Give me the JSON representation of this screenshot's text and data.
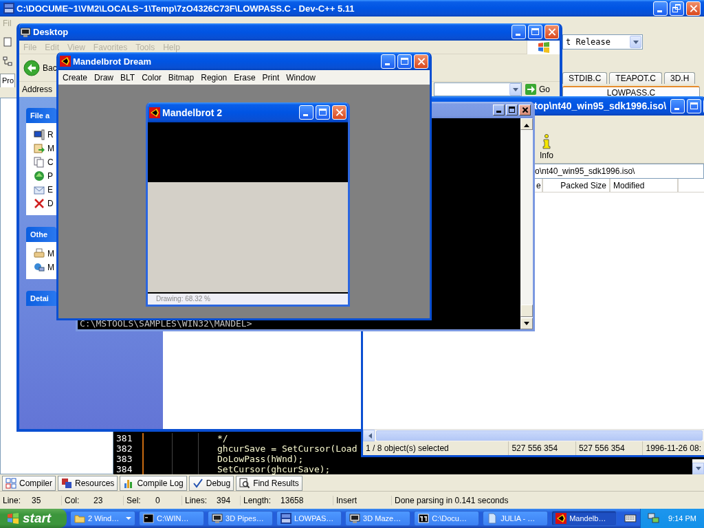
{
  "devcpp": {
    "title": "C:\\DOCUME~1\\VM2\\LOCALS~1\\Temp\\7zO4326C73F\\LOWPASS.C - Dev-C++ 5.11",
    "active": true,
    "menu": [
      "Fil"
    ],
    "config": "t Release",
    "side_tab": "Pro",
    "tabs": [
      {
        "label": "STDIB.C",
        "selected": false
      },
      {
        "label": "TEAPOT.C",
        "selected": false
      },
      {
        "label": "3D.H",
        "selected": false
      },
      {
        "label": "LOWPASS.C",
        "selected": true
      }
    ],
    "code": [
      {
        "line": "381",
        "text": "*/"
      },
      {
        "line": "382",
        "text": "ghcurSave = SetCursor(Load"
      },
      {
        "line": "383",
        "text": "DoLowPass(hWnd);"
      },
      {
        "line": "384",
        "text": "SetCursor(ghcurSave);"
      }
    ],
    "bottom_tabs": [
      "Compiler",
      "Resources",
      "Compile Log",
      "Debug",
      "Find Results"
    ],
    "status": [
      {
        "label": "Line:",
        "value": "35"
      },
      {
        "label": "Col:",
        "value": "23"
      },
      {
        "label": "Sel:",
        "value": "0"
      },
      {
        "label": "Lines:",
        "value": "394"
      },
      {
        "label": "Length:",
        "value": "13658"
      },
      {
        "value": "Insert"
      },
      {
        "value": "Done parsing in 0.141 seconds"
      }
    ]
  },
  "explorer": {
    "title": "Desktop",
    "active": true,
    "menu": [
      "File",
      "Edit",
      "View",
      "Favorites",
      "Tools",
      "Help"
    ],
    "back": "Bac",
    "address_label": "Address",
    "go": "Go",
    "panels": [
      {
        "title": "File a",
        "items": [
          "R",
          "M",
          "C",
          "P",
          "E",
          "D"
        ]
      },
      {
        "title": "Othe",
        "items": [
          "M",
          "M"
        ]
      },
      {
        "title": "Detai"
      }
    ]
  },
  "sevenzip": {
    "title": "top\\nt40_win95_sdk1996.iso\\",
    "active": true,
    "toolbar": [
      "Info"
    ],
    "address": "o\\nt40_win95_sdk1996.iso\\",
    "columns": [
      "e",
      "Packed Size",
      "Modified"
    ],
    "status": [
      "1 / 8 object(s) selected",
      "527 556 354",
      "527 556 354",
      "1996-11-26 08:"
    ]
  },
  "console": {
    "active": false,
    "prompt": "C:\\MSTOOLS\\SAMPLES\\WIN32\\MANDEL>"
  },
  "mandel": {
    "title": "Mandelbrot Dream",
    "active": true,
    "menu": [
      "Create",
      "Draw",
      "BLT",
      "Color",
      "Bitmap",
      "Region",
      "Erase",
      "Print",
      "Window"
    ],
    "child": {
      "title": "Mandelbrot 2",
      "active": true,
      "status": "Drawing: 68.32 %"
    }
  },
  "taskbar": {
    "start": "start",
    "items": [
      {
        "label": "2 Wind…",
        "selected": false
      },
      {
        "label": "C:\\WIN…",
        "selected": false
      },
      {
        "label": "3D Pipes…",
        "selected": false
      },
      {
        "label": "LOWPAS…",
        "selected": false
      },
      {
        "label": "3D Maze…",
        "selected": false
      },
      {
        "label": "C:\\Docu…",
        "selected": false
      },
      {
        "label": "JULIA - …",
        "selected": false
      },
      {
        "label": "Mandelb…",
        "selected": true
      }
    ],
    "clock": "9:14 PM"
  }
}
